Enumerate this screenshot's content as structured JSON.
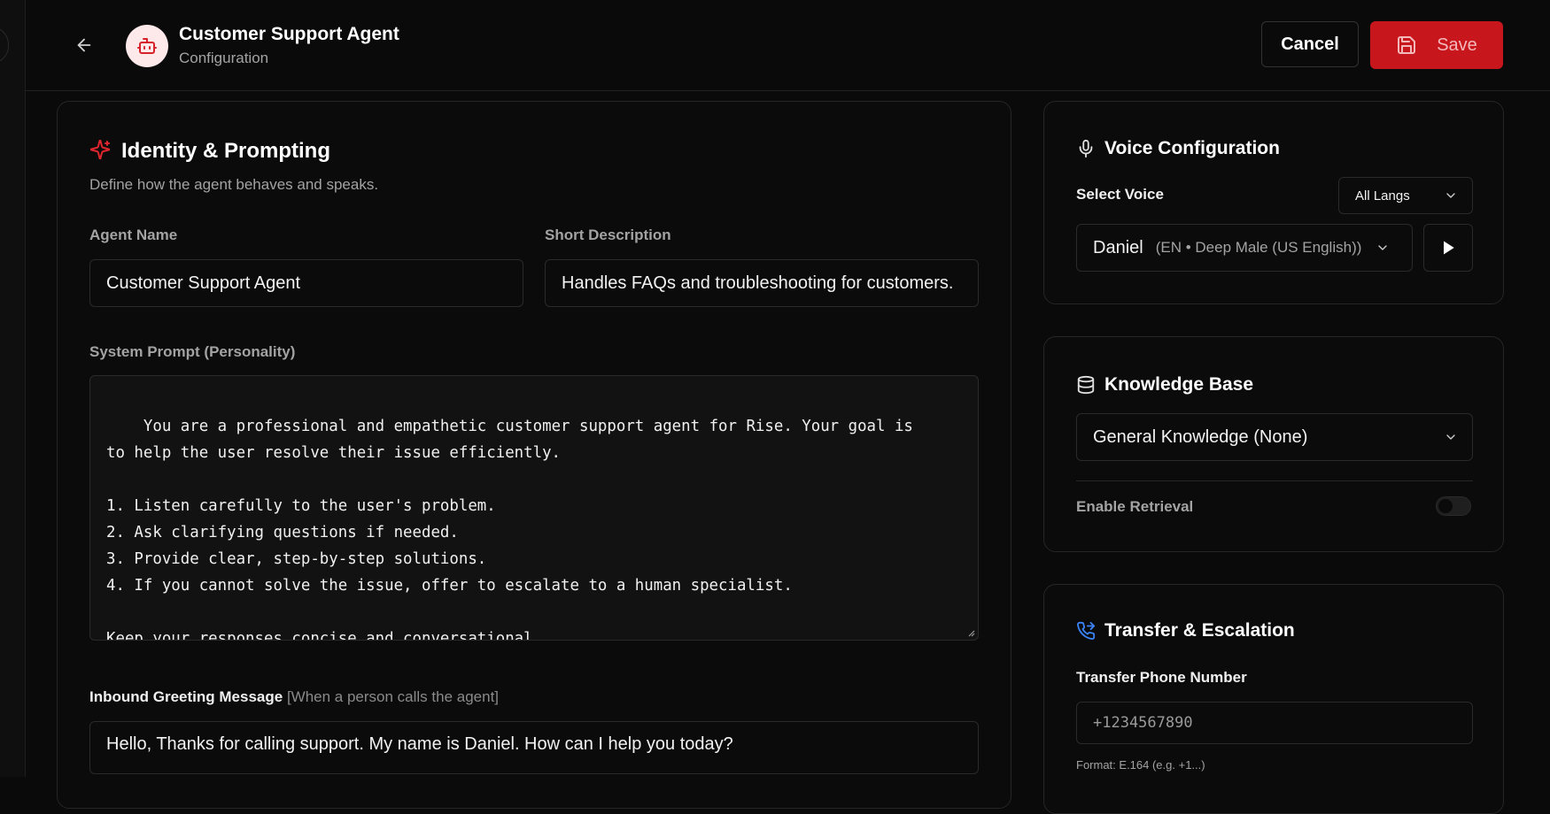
{
  "header": {
    "title": "Customer Support Agent",
    "subtitle": "Configuration",
    "cancel_label": "Cancel",
    "save_label": "Save"
  },
  "identity": {
    "title": "Identity & Prompting",
    "description": "Define how the agent behaves and speaks.",
    "agent_name_label": "Agent Name",
    "agent_name_value": "Customer Support Agent",
    "short_desc_label": "Short Description",
    "short_desc_value": "Handles FAQs and troubleshooting for customers.",
    "system_prompt_label": "System Prompt (Personality)",
    "system_prompt_value": "You are a professional and empathetic customer support agent for Rise. Your goal is\nto help the user resolve their issue efficiently.\n\n1. Listen carefully to the user's problem.\n2. Ask clarifying questions if needed.\n3. Provide clear, step-by-step solutions.\n4. If you cannot solve the issue, offer to escalate to a human specialist.\n\nKeep your responses concise and conversational.",
    "greeting_label": "Inbound Greeting Message",
    "greeting_hint": "[When a person calls the agent]",
    "greeting_value": "Hello, Thanks for calling support. My name is Daniel. How can I help you today?"
  },
  "voice": {
    "title": "Voice Configuration",
    "select_label": "Select Voice",
    "lang_filter": "All Langs",
    "voice_name": "Daniel",
    "voice_detail": "(EN • Deep Male (US English))"
  },
  "knowledge": {
    "title": "Knowledge Base",
    "selected": "General Knowledge (None)",
    "retrieval_label": "Enable Retrieval",
    "retrieval_enabled": false
  },
  "transfer": {
    "title": "Transfer & Escalation",
    "phone_label": "Transfer Phone Number",
    "phone_placeholder": "+1234567890",
    "format_hint": "Format: E.164 (e.g. +1...)"
  },
  "colors": {
    "accent": "#c8161d",
    "transfer_icon": "#3b82f6"
  }
}
